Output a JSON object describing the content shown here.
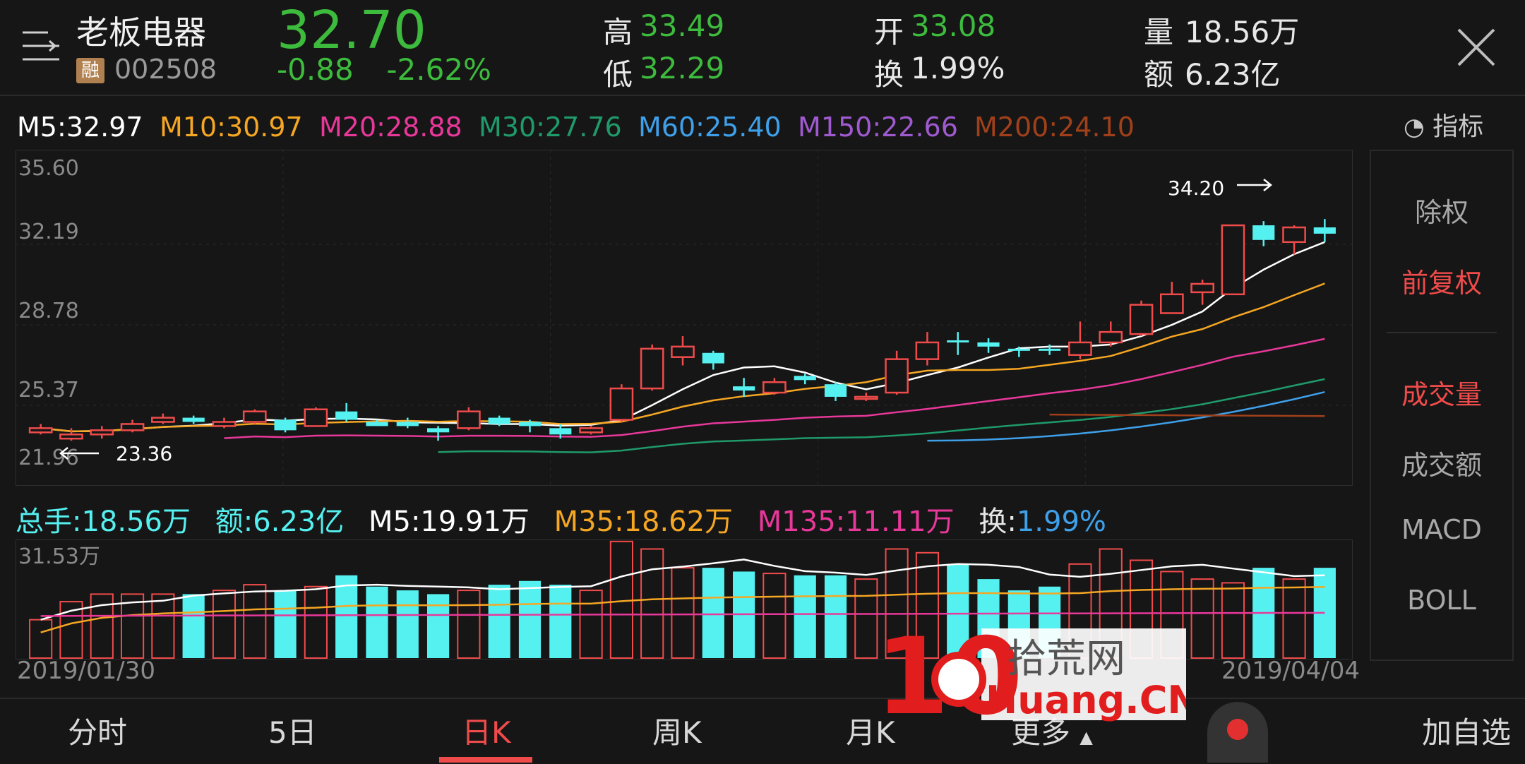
{
  "header": {
    "stock_name": "老板电器",
    "badge": "融",
    "code": "002508",
    "price": "32.70",
    "change": "-0.88  -2.62%",
    "high_label": "高",
    "high": "33.49",
    "low_label": "低",
    "low": "32.29",
    "open_label": "开",
    "open": "33.08",
    "turnover_label": "换",
    "turnover": "1.99%",
    "volume_label": "量",
    "volume": "18.56万",
    "amount_label": "额",
    "amount": "6.23亿"
  },
  "ma": {
    "m5": "M5:32.97",
    "m10": "M10:30.97",
    "m20": "M20:28.88",
    "m30": "M30:27.76",
    "m60": "M60:25.40",
    "m150": "M150:22.66",
    "m200": "M200:24.10"
  },
  "indicator_label": "指标",
  "chart": {
    "y_ticks": [
      "35.60",
      "32.19",
      "28.78",
      "25.37",
      "21.96"
    ],
    "max_label": "34.20",
    "min_label": "23.36"
  },
  "volume": {
    "total": "总手:18.56万",
    "amount": "额:6.23亿",
    "m5": "M5:19.91万",
    "m35": "M35:18.62万",
    "m135": "M135:11.11万",
    "turnover_label": "换:",
    "turnover_value": "1.99%",
    "y_max": "31.53万"
  },
  "dates": {
    "start": "2019/01/30",
    "end": "2019/04/04"
  },
  "side": {
    "items": [
      "除权",
      "前复权",
      "成交量",
      "成交额",
      "MACD",
      "BOLL"
    ]
  },
  "tabs": [
    "分时",
    "5日",
    "日K",
    "周K",
    "月K",
    "更多",
    "加自选"
  ],
  "watermark": {
    "digits": "10",
    "cn": "拾荒网",
    "en": "Huang.CN"
  },
  "colors": {
    "up": "#f04b4b",
    "down": "#55f0f0",
    "green": "#3dbb3d",
    "m5": "#ffffff",
    "m10": "#f5a623",
    "m20": "#e8389a",
    "m30": "#1f9a6a",
    "m60": "#3fa0ea",
    "m150": "#a05ad0",
    "m200": "#a0401a"
  },
  "chart_data": {
    "type": "candlestick",
    "ylim": [
      21.96,
      35.6
    ],
    "candles": [
      [
        23.3,
        23.5,
        23.2,
        23.7
      ],
      [
        23.0,
        23.2,
        22.9,
        23.5
      ],
      [
        23.2,
        23.4,
        23.0,
        23.6
      ],
      [
        23.4,
        23.7,
        23.3,
        23.9
      ],
      [
        23.8,
        24.0,
        23.7,
        24.2
      ],
      [
        24.0,
        23.8,
        23.7,
        24.1
      ],
      [
        23.6,
        23.8,
        23.5,
        24.0
      ],
      [
        23.8,
        24.3,
        23.7,
        24.4
      ],
      [
        23.9,
        23.4,
        23.3,
        24.0
      ],
      [
        23.6,
        24.4,
        23.6,
        24.5
      ],
      [
        24.3,
        23.9,
        23.8,
        24.7
      ],
      [
        23.8,
        23.6,
        23.6,
        23.9
      ],
      [
        23.8,
        23.6,
        23.5,
        24.0
      ],
      [
        23.5,
        23.3,
        22.9,
        23.6
      ],
      [
        23.5,
        24.3,
        23.4,
        24.5
      ],
      [
        24.0,
        23.7,
        23.6,
        24.1
      ],
      [
        23.8,
        23.6,
        23.3,
        23.9
      ],
      [
        23.5,
        23.2,
        23.0,
        23.7
      ],
      [
        23.3,
        23.5,
        23.2,
        23.6
      ],
      [
        23.9,
        25.4,
        23.8,
        25.6
      ],
      [
        25.4,
        27.3,
        25.3,
        27.5
      ],
      [
        26.9,
        27.4,
        26.5,
        27.9
      ],
      [
        27.1,
        26.6,
        26.3,
        27.2
      ],
      [
        25.5,
        25.3,
        25.0,
        25.9
      ],
      [
        25.2,
        25.7,
        25.1,
        25.9
      ],
      [
        26.0,
        25.8,
        25.6,
        26.1
      ],
      [
        25.6,
        25.0,
        24.8,
        25.7
      ],
      [
        24.9,
        25.0,
        24.8,
        25.2
      ],
      [
        25.2,
        26.8,
        25.1,
        27.2
      ],
      [
        26.8,
        27.6,
        26.5,
        28.1
      ],
      [
        27.7,
        27.6,
        27.0,
        28.1
      ],
      [
        27.6,
        27.4,
        27.1,
        27.8
      ],
      [
        27.3,
        27.2,
        26.9,
        27.4
      ],
      [
        27.3,
        27.2,
        27.0,
        27.5
      ],
      [
        27.0,
        27.6,
        26.8,
        28.6
      ],
      [
        27.6,
        28.1,
        27.4,
        28.6
      ],
      [
        28.0,
        29.4,
        27.9,
        29.6
      ],
      [
        29.0,
        29.9,
        29.0,
        30.5
      ],
      [
        30.0,
        30.4,
        29.4,
        30.6
      ],
      [
        29.9,
        33.2,
        29.9,
        33.2
      ],
      [
        33.2,
        32.5,
        32.2,
        33.4
      ],
      [
        32.4,
        33.1,
        31.8,
        33.2
      ],
      [
        33.1,
        32.8,
        32.4,
        33.5
      ]
    ],
    "volume_ymax": 31.53,
    "volumes": [
      10.2,
      15.0,
      17.0,
      17.0,
      17.0,
      17.0,
      18.0,
      19.5,
      18.0,
      19.0,
      22.0,
      19.0,
      18.0,
      17.0,
      18.0,
      19.5,
      20.5,
      19.5,
      18.0,
      31.0,
      29.0,
      24.0,
      24.0,
      23.0,
      22.5,
      22.0,
      22.0,
      21.0,
      29.0,
      28.0,
      25.0,
      21.0,
      18.0,
      19.0,
      25.0,
      29.0,
      26.0,
      23.0,
      21.0,
      20.0,
      24.0,
      21.0,
      24.0
    ]
  }
}
